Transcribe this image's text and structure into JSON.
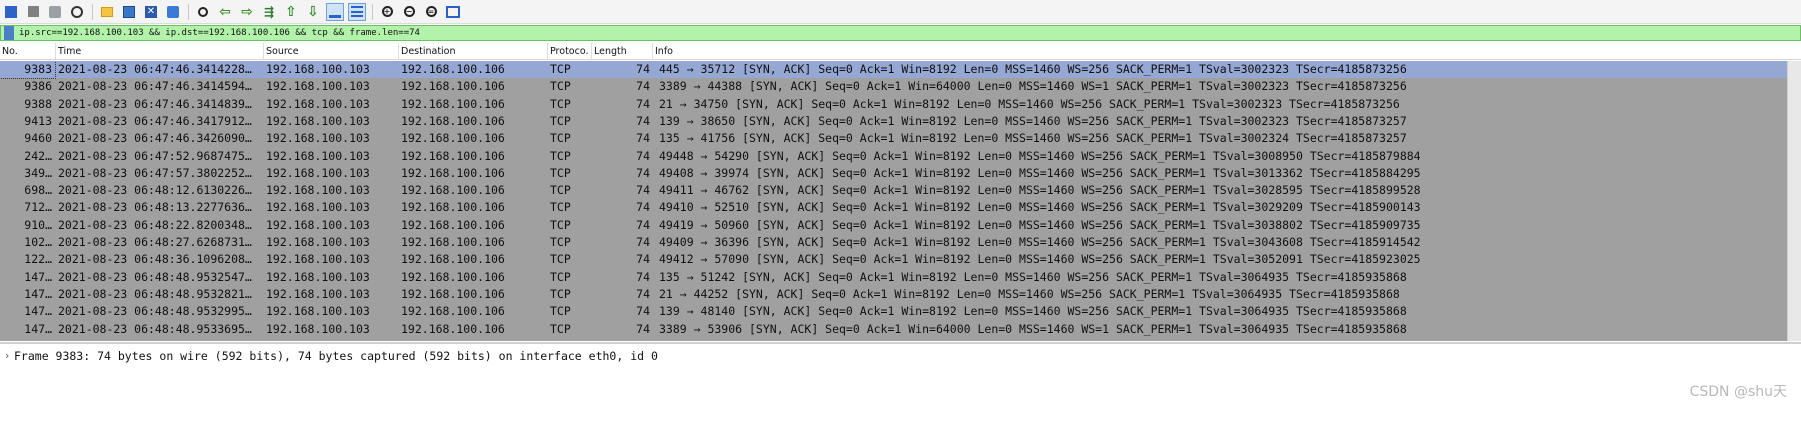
{
  "toolbar": {
    "buttons": [
      {
        "id": "start-capture",
        "icon": "shark-fin-icon"
      },
      {
        "id": "stop-capture",
        "icon": "stop-icon"
      },
      {
        "id": "restart-capture",
        "icon": "restart-icon"
      },
      {
        "id": "capture-options",
        "icon": "gear-icon"
      },
      {
        "id": "open-file",
        "icon": "folder-icon"
      },
      {
        "id": "save-file",
        "icon": "save-icon"
      },
      {
        "id": "close-file",
        "icon": "close-icon"
      },
      {
        "id": "reload-file",
        "icon": "reload-icon"
      },
      {
        "id": "find-packet",
        "icon": "magnifier-icon"
      },
      {
        "id": "go-back",
        "icon": "arrow-left-icon"
      },
      {
        "id": "go-forward",
        "icon": "arrow-right-icon"
      },
      {
        "id": "go-to-packet",
        "icon": "goto-icon"
      },
      {
        "id": "go-first",
        "icon": "arrow-up-icon"
      },
      {
        "id": "go-last",
        "icon": "arrow-down-icon"
      },
      {
        "id": "autoscroll",
        "icon": "autoscroll-icon"
      },
      {
        "id": "colorize",
        "icon": "colorize-icon"
      },
      {
        "id": "zoom-in",
        "icon": "zoom-in-icon"
      },
      {
        "id": "zoom-out",
        "icon": "zoom-out-icon"
      },
      {
        "id": "zoom-normal",
        "icon": "zoom-normal-icon"
      },
      {
        "id": "resize-columns",
        "icon": "resize-columns-icon"
      }
    ]
  },
  "filter": {
    "text": "ip.src==192.168.100.103 && ip.dst==192.168.100.106 && tcp && frame.len==74",
    "background": "#b2f2aa"
  },
  "columns": {
    "no": "No.",
    "time": "Time",
    "source": "Source",
    "destination": "Destination",
    "protocol": "Protoco.",
    "length": "Length",
    "info": "Info"
  },
  "packets": [
    {
      "no": "9383",
      "time": "2021-08-23 06:47:46.3414228…",
      "src": "192.168.100.103",
      "dst": "192.168.100.106",
      "proto": "TCP",
      "len": "74",
      "info": "445 → 35712 [SYN, ACK] Seq=0 Ack=1 Win=8192 Len=0 MSS=1460 WS=256 SACK_PERM=1 TSval=3002323 TSecr=4185873256"
    },
    {
      "no": "9386",
      "time": "2021-08-23 06:47:46.3414594…",
      "src": "192.168.100.103",
      "dst": "192.168.100.106",
      "proto": "TCP",
      "len": "74",
      "info": "3389 → 44388 [SYN, ACK] Seq=0 Ack=1 Win=64000 Len=0 MSS=1460 WS=1 SACK_PERM=1 TSval=3002323 TSecr=4185873256"
    },
    {
      "no": "9388",
      "time": "2021-08-23 06:47:46.3414839…",
      "src": "192.168.100.103",
      "dst": "192.168.100.106",
      "proto": "TCP",
      "len": "74",
      "info": "21 → 34750 [SYN, ACK] Seq=0 Ack=1 Win=8192 Len=0 MSS=1460 WS=256 SACK_PERM=1 TSval=3002323 TSecr=4185873256"
    },
    {
      "no": "9413",
      "time": "2021-08-23 06:47:46.3417912…",
      "src": "192.168.100.103",
      "dst": "192.168.100.106",
      "proto": "TCP",
      "len": "74",
      "info": "139 → 38650 [SYN, ACK] Seq=0 Ack=1 Win=8192 Len=0 MSS=1460 WS=256 SACK_PERM=1 TSval=3002323 TSecr=4185873257"
    },
    {
      "no": "9460",
      "time": "2021-08-23 06:47:46.3426090…",
      "src": "192.168.100.103",
      "dst": "192.168.100.106",
      "proto": "TCP",
      "len": "74",
      "info": "135 → 41756 [SYN, ACK] Seq=0 Ack=1 Win=8192 Len=0 MSS=1460 WS=256 SACK_PERM=1 TSval=3002324 TSecr=4185873257"
    },
    {
      "no": "242…",
      "time": "2021-08-23 06:47:52.9687475…",
      "src": "192.168.100.103",
      "dst": "192.168.100.106",
      "proto": "TCP",
      "len": "74",
      "info": "49448 → 54290 [SYN, ACK] Seq=0 Ack=1 Win=8192 Len=0 MSS=1460 WS=256 SACK_PERM=1 TSval=3008950 TSecr=4185879884"
    },
    {
      "no": "349…",
      "time": "2021-08-23 06:47:57.3802252…",
      "src": "192.168.100.103",
      "dst": "192.168.100.106",
      "proto": "TCP",
      "len": "74",
      "info": "49408 → 39974 [SYN, ACK] Seq=0 Ack=1 Win=8192 Len=0 MSS=1460 WS=256 SACK_PERM=1 TSval=3013362 TSecr=4185884295"
    },
    {
      "no": "698…",
      "time": "2021-08-23 06:48:12.6130226…",
      "src": "192.168.100.103",
      "dst": "192.168.100.106",
      "proto": "TCP",
      "len": "74",
      "info": "49411 → 46762 [SYN, ACK] Seq=0 Ack=1 Win=8192 Len=0 MSS=1460 WS=256 SACK_PERM=1 TSval=3028595 TSecr=4185899528"
    },
    {
      "no": "712…",
      "time": "2021-08-23 06:48:13.2277636…",
      "src": "192.168.100.103",
      "dst": "192.168.100.106",
      "proto": "TCP",
      "len": "74",
      "info": "49410 → 52510 [SYN, ACK] Seq=0 Ack=1 Win=8192 Len=0 MSS=1460 WS=256 SACK_PERM=1 TSval=3029209 TSecr=4185900143"
    },
    {
      "no": "910…",
      "time": "2021-08-23 06:48:22.8200348…",
      "src": "192.168.100.103",
      "dst": "192.168.100.106",
      "proto": "TCP",
      "len": "74",
      "info": "49419 → 50960 [SYN, ACK] Seq=0 Ack=1 Win=8192 Len=0 MSS=1460 WS=256 SACK_PERM=1 TSval=3038802 TSecr=4185909735"
    },
    {
      "no": "102…",
      "time": "2021-08-23 06:48:27.6268731…",
      "src": "192.168.100.103",
      "dst": "192.168.100.106",
      "proto": "TCP",
      "len": "74",
      "info": "49409 → 36396 [SYN, ACK] Seq=0 Ack=1 Win=8192 Len=0 MSS=1460 WS=256 SACK_PERM=1 TSval=3043608 TSecr=4185914542"
    },
    {
      "no": "122…",
      "time": "2021-08-23 06:48:36.1096208…",
      "src": "192.168.100.103",
      "dst": "192.168.100.106",
      "proto": "TCP",
      "len": "74",
      "info": "49412 → 57090 [SYN, ACK] Seq=0 Ack=1 Win=8192 Len=0 MSS=1460 WS=256 SACK_PERM=1 TSval=3052091 TSecr=4185923025"
    },
    {
      "no": "147…",
      "time": "2021-08-23 06:48:48.9532547…",
      "src": "192.168.100.103",
      "dst": "192.168.100.106",
      "proto": "TCP",
      "len": "74",
      "info": "135 → 51242 [SYN, ACK] Seq=0 Ack=1 Win=8192 Len=0 MSS=1460 WS=256 SACK_PERM=1 TSval=3064935 TSecr=4185935868"
    },
    {
      "no": "147…",
      "time": "2021-08-23 06:48:48.9532821…",
      "src": "192.168.100.103",
      "dst": "192.168.100.106",
      "proto": "TCP",
      "len": "74",
      "info": "21 → 44252 [SYN, ACK] Seq=0 Ack=1 Win=8192 Len=0 MSS=1460 WS=256 SACK_PERM=1 TSval=3064935 TSecr=4185935868"
    },
    {
      "no": "147…",
      "time": "2021-08-23 06:48:48.9532995…",
      "src": "192.168.100.103",
      "dst": "192.168.100.106",
      "proto": "TCP",
      "len": "74",
      "info": "139 → 48140 [SYN, ACK] Seq=0 Ack=1 Win=8192 Len=0 MSS=1460 WS=256 SACK_PERM=1 TSval=3064935 TSecr=4185935868"
    },
    {
      "no": "147…",
      "time": "2021-08-23 06:48:48.9533695…",
      "src": "192.168.100.103",
      "dst": "192.168.100.106",
      "proto": "TCP",
      "len": "74",
      "info": "3389 → 53906 [SYN, ACK] Seq=0 Ack=1 Win=64000 Len=0 MSS=1460 WS=1 SACK_PERM=1 TSval=3064935 TSecr=4185935868"
    }
  ],
  "colors": {
    "row_background": "#a0a0a0",
    "selected_row": "#95a8d3",
    "filter_valid": "#b2f2aa"
  },
  "details": {
    "expander": "›",
    "line": "Frame 9383: 74 bytes on wire (592 bits), 74 bytes captured (592 bits) on interface eth0, id 0"
  },
  "watermark": "CSDN @shu天"
}
